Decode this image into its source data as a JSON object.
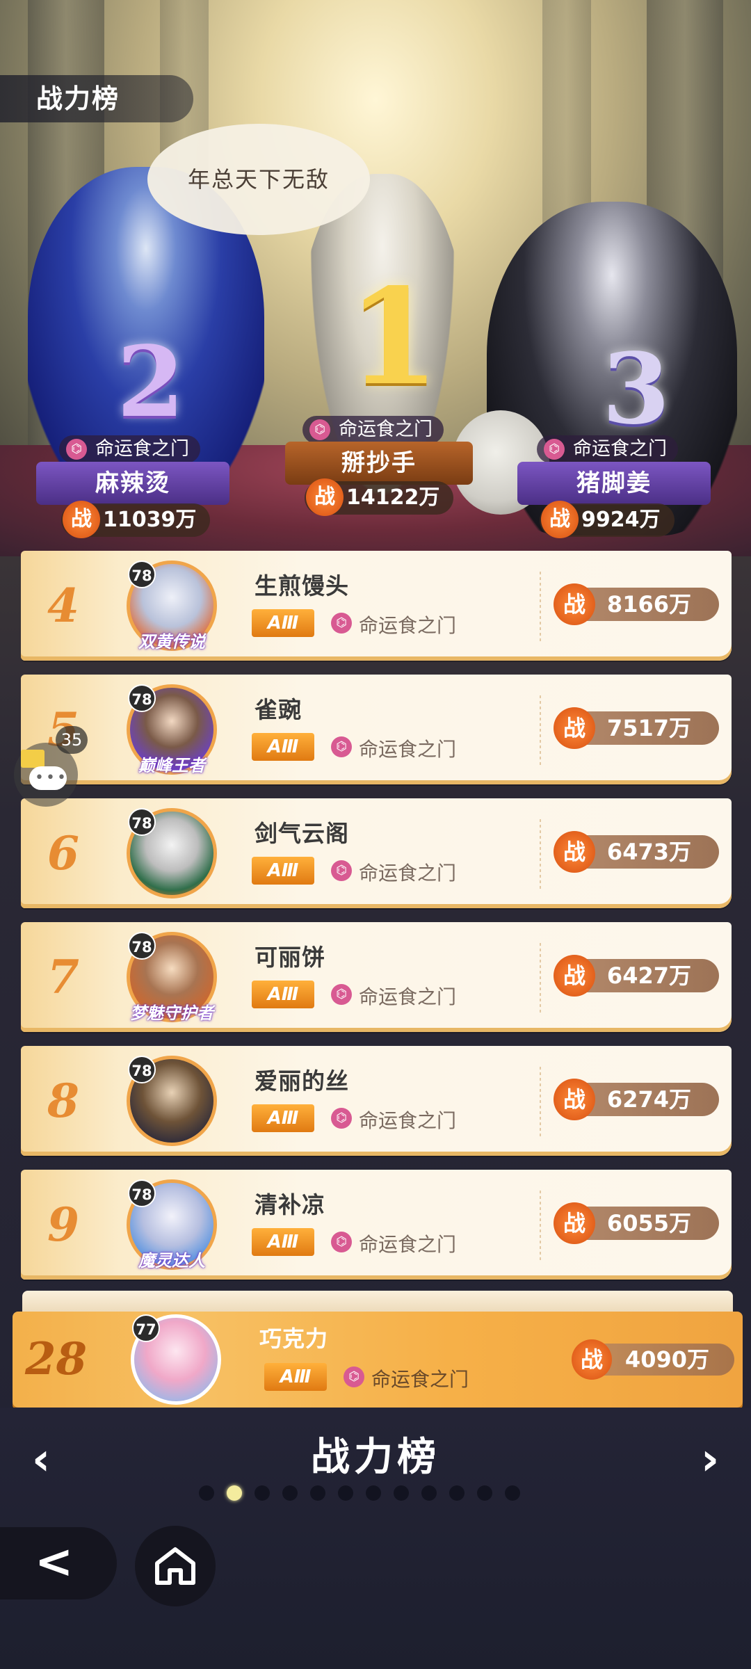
{
  "page_title": "战力榜",
  "speech_bubble": "年总天下无敌",
  "podium": [
    {
      "rank": "1",
      "guild": "命运食之门",
      "name": "掰抄手",
      "power": "14122万"
    },
    {
      "rank": "2",
      "guild": "命运食之门",
      "name": "麻辣烫",
      "power": "11039万"
    },
    {
      "rank": "3",
      "guild": "命运食之门",
      "name": "猪脚姜",
      "power": "9924万"
    }
  ],
  "power_glyph": "战",
  "guild_glyph": "⌬",
  "list": [
    {
      "rank": "4",
      "level": "78",
      "badge": "双黄传说",
      "name": "生煎馒头",
      "tier": "AⅢ",
      "guild": "命运食之门",
      "power": "8166万"
    },
    {
      "rank": "5",
      "level": "78",
      "badge": "巅峰王者",
      "name": "雀豌",
      "tier": "AⅢ",
      "guild": "命运食之门",
      "power": "7517万"
    },
    {
      "rank": "6",
      "level": "78",
      "badge": "",
      "name": "剑气云阁",
      "tier": "AⅢ",
      "guild": "命运食之门",
      "power": "6473万"
    },
    {
      "rank": "7",
      "level": "78",
      "badge": "梦魅守护者",
      "name": "可丽饼",
      "tier": "AⅢ",
      "guild": "命运食之门",
      "power": "6427万"
    },
    {
      "rank": "8",
      "level": "78",
      "badge": "",
      "name": "爱丽的丝",
      "tier": "AⅢ",
      "guild": "命运食之门",
      "power": "6274万"
    },
    {
      "rank": "9",
      "level": "78",
      "badge": "魔灵达人",
      "name": "清补凉",
      "tier": "AⅢ",
      "guild": "命运食之门",
      "power": "6055万"
    }
  ],
  "my_entry": {
    "rank": "28",
    "level": "77",
    "name": "巧克力",
    "tier": "AⅢ",
    "guild": "命运食之门",
    "power": "4090万"
  },
  "chat": {
    "count": "35"
  },
  "nav": {
    "title": "战力榜",
    "prev": "‹",
    "next": "›",
    "page_count": 12,
    "active_index": 1
  },
  "back_glyph": "<",
  "colors": {
    "accent": "#e78c33",
    "tier_badge": "#f0a020",
    "guild_icon": "#d85a92",
    "power_pill": "#a87d5f"
  }
}
